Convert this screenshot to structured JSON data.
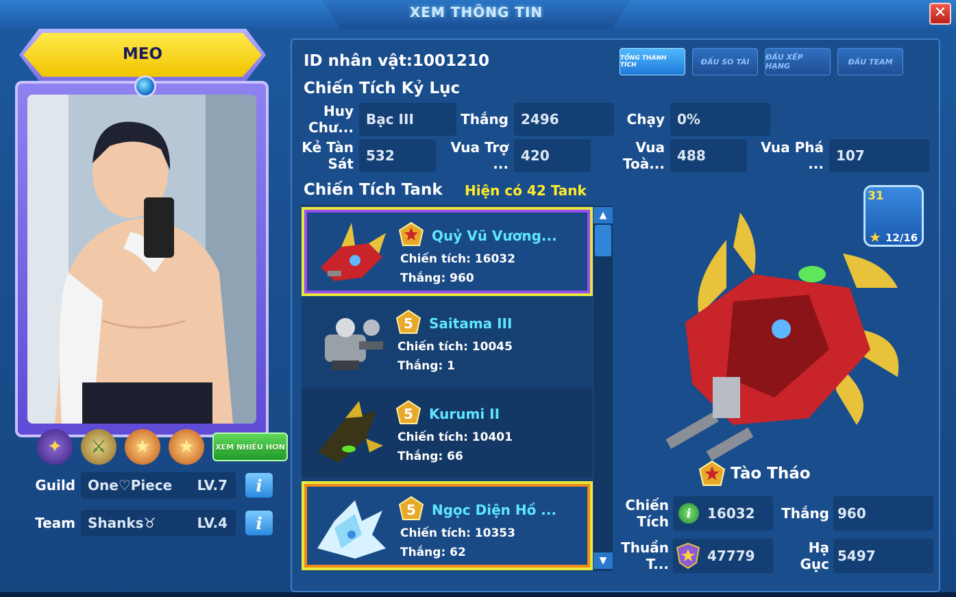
{
  "window": {
    "title": "XEM THÔNG TIN",
    "close_label": "✕"
  },
  "player": {
    "name": "MEO",
    "guild": {
      "label": "Guild",
      "name": "One♡Piece",
      "level": "LV.7"
    },
    "team": {
      "label": "Team",
      "name": "Shanks♉",
      "level": "LV.4"
    },
    "more_button": "XEM NHIỀU HƠN"
  },
  "header": {
    "id_line": "ID nhân vật:1001210",
    "record_title": "Chiến Tích Kỷ Lục"
  },
  "tabs": [
    {
      "label": "TỔNG THÀNH TÍCH",
      "active": true
    },
    {
      "label": "ĐẤU SO TÀI",
      "active": false
    },
    {
      "label": "ĐẤU XẾP HẠNG",
      "active": false
    },
    {
      "label": "ĐẤU TEAM",
      "active": false
    }
  ],
  "stats": {
    "medal": {
      "label": "Huy Chư...",
      "value": "Bạc III"
    },
    "wins": {
      "label": "Thắng",
      "value": "2496"
    },
    "run": {
      "label": "Chạy",
      "value": "0%"
    },
    "slayer": {
      "label": "Kẻ Tàn Sát",
      "value": "532"
    },
    "support": {
      "label": "Vua Trợ ...",
      "value": "420"
    },
    "full": {
      "label": "Vua Toà...",
      "value": "488"
    },
    "destroy": {
      "label": "Vua Phá ...",
      "value": "107"
    }
  },
  "tanks": {
    "title": "Chiến Tích Tank",
    "count": "Hiện có 42 Tank",
    "items": [
      {
        "name": "Quỷ Vũ Vương...",
        "record": "Chiến tích: 16032",
        "wins": "Thắng: 960",
        "rank": "star"
      },
      {
        "name": "Saitama III",
        "record": "Chiến tích: 10045",
        "wins": "Thắng: 1",
        "rank": "5"
      },
      {
        "name": "Kurumi II",
        "record": "Chiến tích: 10401",
        "wins": "Thắng: 66",
        "rank": "5"
      },
      {
        "name": "Ngọc Diện Hồ ...",
        "record": "Chiến tích: 10353",
        "wins": "Thắng: 62",
        "rank": "5"
      }
    ]
  },
  "selected_tank": {
    "name": "Tào Tháo",
    "level": "31",
    "stars": "12/16",
    "record": {
      "label": "Chiến Tích",
      "value": "16032"
    },
    "wins": {
      "label": "Thắng",
      "value": "960"
    },
    "mastery": {
      "label": "Thuần T...",
      "value": "47779"
    },
    "kills": {
      "label": "Hạ Gục",
      "value": "5497"
    }
  },
  "colors": {
    "accent": "#5fe6ff",
    "highlight": "#ffec2a",
    "panel": "#1a4d8c"
  }
}
